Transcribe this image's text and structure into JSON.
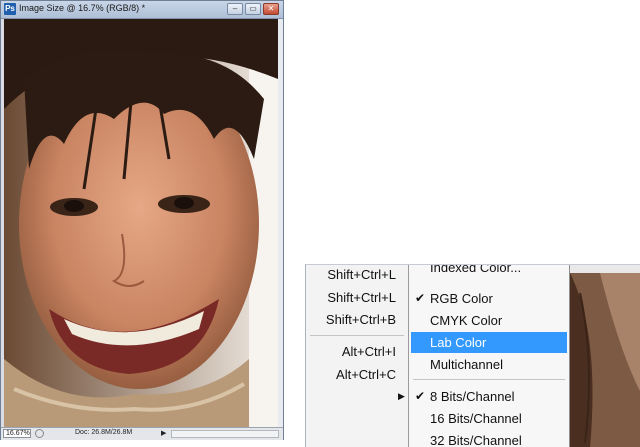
{
  "document_window": {
    "title": "Image Size @ 16.7% (RGB/8) *",
    "app_icon": "Ps",
    "buttons": {
      "minimize": "–",
      "restore": "▭",
      "close": "✕"
    },
    "status": {
      "zoom": "16.67%",
      "doc_size": "Doc: 26.8M/26.8M",
      "arrow": "▶"
    }
  },
  "mode_menu": {
    "shortcuts": [
      {
        "text": "Shift+Ctrl+L",
        "icon": ""
      },
      {
        "text": "Shift+Ctrl+L",
        "icon": ""
      },
      {
        "text": "Shift+Ctrl+B",
        "icon": ""
      },
      {
        "text": "Alt+Ctrl+I",
        "icon": ""
      },
      {
        "text": "Alt+Ctrl+C",
        "icon": ""
      }
    ],
    "submenu_arrow": "▶",
    "items": [
      {
        "label": "Indexed Color...",
        "checked": false,
        "highlighted": false
      },
      {
        "label": "RGB Color",
        "checked": true,
        "highlighted": false
      },
      {
        "label": "CMYK Color",
        "checked": false,
        "highlighted": false
      },
      {
        "label": "Lab Color",
        "checked": false,
        "highlighted": true
      },
      {
        "label": "Multichannel",
        "checked": false,
        "highlighted": false
      },
      {
        "label": "8 Bits/Channel",
        "checked": true,
        "highlighted": false
      },
      {
        "label": "16 Bits/Channel",
        "checked": false,
        "highlighted": false
      },
      {
        "label": "32 Bits/Channel",
        "checked": false,
        "highlighted": false
      }
    ],
    "check_glyph": "✔",
    "highlight_color": "#3399ff"
  },
  "icons": {
    "cursor": "mouse-pointer-icon"
  }
}
